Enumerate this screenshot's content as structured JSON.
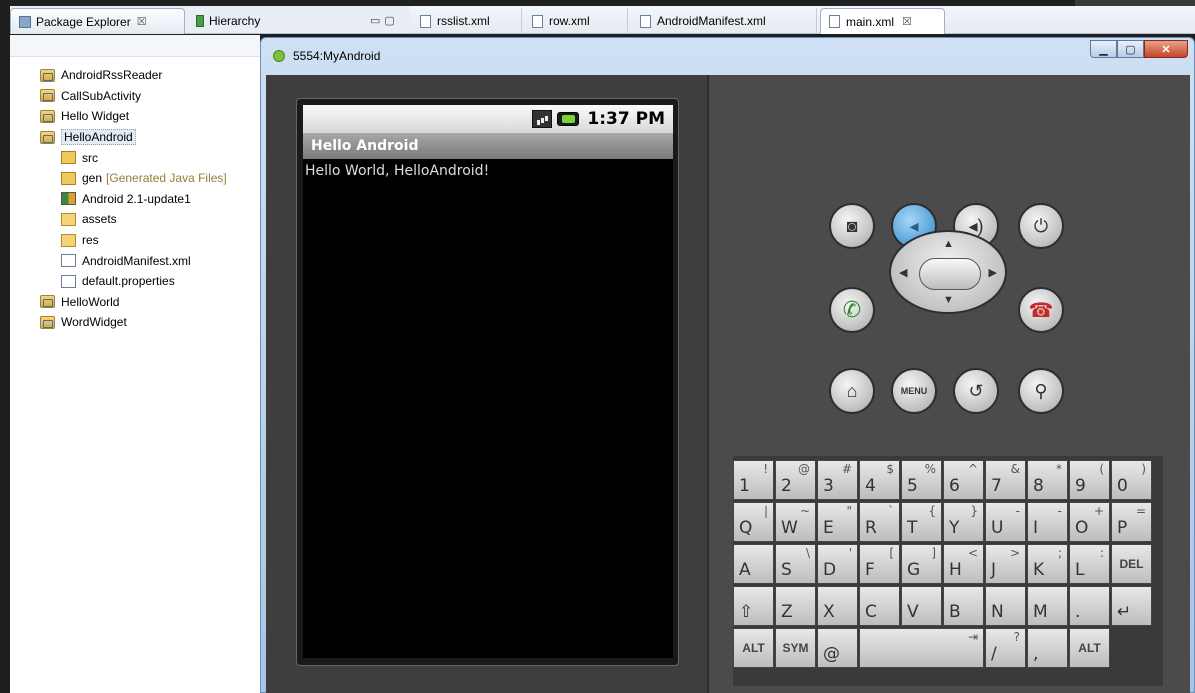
{
  "eclipse": {
    "left_tabs": {
      "package_explorer": "Package Explorer",
      "hierarchy": "Hierarchy",
      "close_glyph": "☒"
    },
    "editor_tabs": [
      {
        "label": "rsslist.xml"
      },
      {
        "label": "row.xml"
      },
      {
        "label": "AndroidManifest.xml"
      },
      {
        "label": "main.xml",
        "active": true
      }
    ],
    "tree": [
      {
        "label": "AndroidRssReader",
        "icon": "project-icon",
        "level": 1
      },
      {
        "label": "CallSubActivity",
        "icon": "project-icon",
        "level": 1
      },
      {
        "label": "Hello Widget",
        "icon": "project-icon",
        "level": 1
      },
      {
        "label": "HelloAndroid",
        "icon": "project-icon",
        "level": 1,
        "selected": true
      },
      {
        "label": "src",
        "icon": "package-folder-icon",
        "level": 2
      },
      {
        "label": "gen",
        "note": "[Generated Java Files]",
        "icon": "package-folder-icon",
        "level": 2
      },
      {
        "label": "Android 2.1-update1",
        "icon": "library-icon",
        "level": 2
      },
      {
        "label": "assets",
        "icon": "folder-icon",
        "level": 2
      },
      {
        "label": "res",
        "icon": "folder-icon",
        "level": 2
      },
      {
        "label": "AndroidManifest.xml",
        "icon": "xml-file-icon",
        "level": 2
      },
      {
        "label": "default.properties",
        "icon": "properties-file-icon",
        "level": 2
      },
      {
        "label": "HelloWorld",
        "icon": "project-icon",
        "level": 1
      },
      {
        "label": "WordWidget",
        "icon": "project-icon",
        "level": 1
      }
    ]
  },
  "emulator": {
    "window_title": "5554:MyAndroid",
    "window_buttons": {
      "minimize": "▁",
      "maximize": "▢",
      "close": "✕"
    },
    "status_bar": {
      "time": "1:37 PM"
    },
    "app": {
      "title": "Hello Android",
      "text": "Hello World, HelloAndroid!"
    },
    "controls": {
      "camera": "camera-icon",
      "volume_down": "volume-down-icon",
      "volume_up": "volume-up-icon",
      "power": "power-icon",
      "call": "call-icon",
      "end_call": "end-call-icon",
      "home": "home-icon",
      "menu_label": "MENU",
      "back": "back-icon",
      "search": "search-icon",
      "dpad_up": "▲",
      "dpad_down": "▼",
      "dpad_left": "◀",
      "dpad_right": "▶"
    },
    "keyboard": {
      "row1": [
        {
          "m": "1",
          "s": "!"
        },
        {
          "m": "2",
          "s": "@"
        },
        {
          "m": "3",
          "s": "#"
        },
        {
          "m": "4",
          "s": "$"
        },
        {
          "m": "5",
          "s": "%"
        },
        {
          "m": "6",
          "s": "^"
        },
        {
          "m": "7",
          "s": "&"
        },
        {
          "m": "8",
          "s": "*"
        },
        {
          "m": "9",
          "s": "("
        },
        {
          "m": "0",
          "s": ")"
        }
      ],
      "row2": [
        {
          "m": "Q",
          "s": "|"
        },
        {
          "m": "W",
          "s": "~"
        },
        {
          "m": "E",
          "s": "\""
        },
        {
          "m": "R",
          "s": "`"
        },
        {
          "m": "T",
          "s": "{"
        },
        {
          "m": "Y",
          "s": "}"
        },
        {
          "m": "U",
          "s": "-"
        },
        {
          "m": "I",
          "s": "-"
        },
        {
          "m": "O",
          "s": "+"
        },
        {
          "m": "P",
          "s": "="
        }
      ],
      "row3": [
        {
          "m": "A",
          "s": ""
        },
        {
          "m": "S",
          "s": "\\"
        },
        {
          "m": "D",
          "s": "'"
        },
        {
          "m": "F",
          "s": "["
        },
        {
          "m": "G",
          "s": "]"
        },
        {
          "m": "H",
          "s": "<"
        },
        {
          "m": "J",
          "s": ">"
        },
        {
          "m": "K",
          "s": ";"
        },
        {
          "m": "L",
          "s": ":"
        },
        {
          "m": "DEL",
          "s": "",
          "c": true
        }
      ],
      "row4": [
        {
          "m": "⇧",
          "s": ""
        },
        {
          "m": "Z",
          "s": ""
        },
        {
          "m": "X",
          "s": ""
        },
        {
          "m": "C",
          "s": ""
        },
        {
          "m": "V",
          "s": ""
        },
        {
          "m": "B",
          "s": ""
        },
        {
          "m": "N",
          "s": ""
        },
        {
          "m": "M",
          "s": ""
        },
        {
          "m": ".",
          "s": ""
        },
        {
          "m": "↵",
          "s": ""
        }
      ],
      "row5": [
        {
          "m": "ALT",
          "s": "",
          "c": true
        },
        {
          "m": "SYM",
          "s": "",
          "c": true
        },
        {
          "m": "@",
          "s": ""
        },
        {
          "m": "",
          "s": "⇥",
          "space": true
        },
        {
          "m": "/",
          "s": "?"
        },
        {
          "m": ",",
          "s": ""
        },
        {
          "m": "ALT",
          "s": "",
          "c": true
        }
      ]
    }
  }
}
